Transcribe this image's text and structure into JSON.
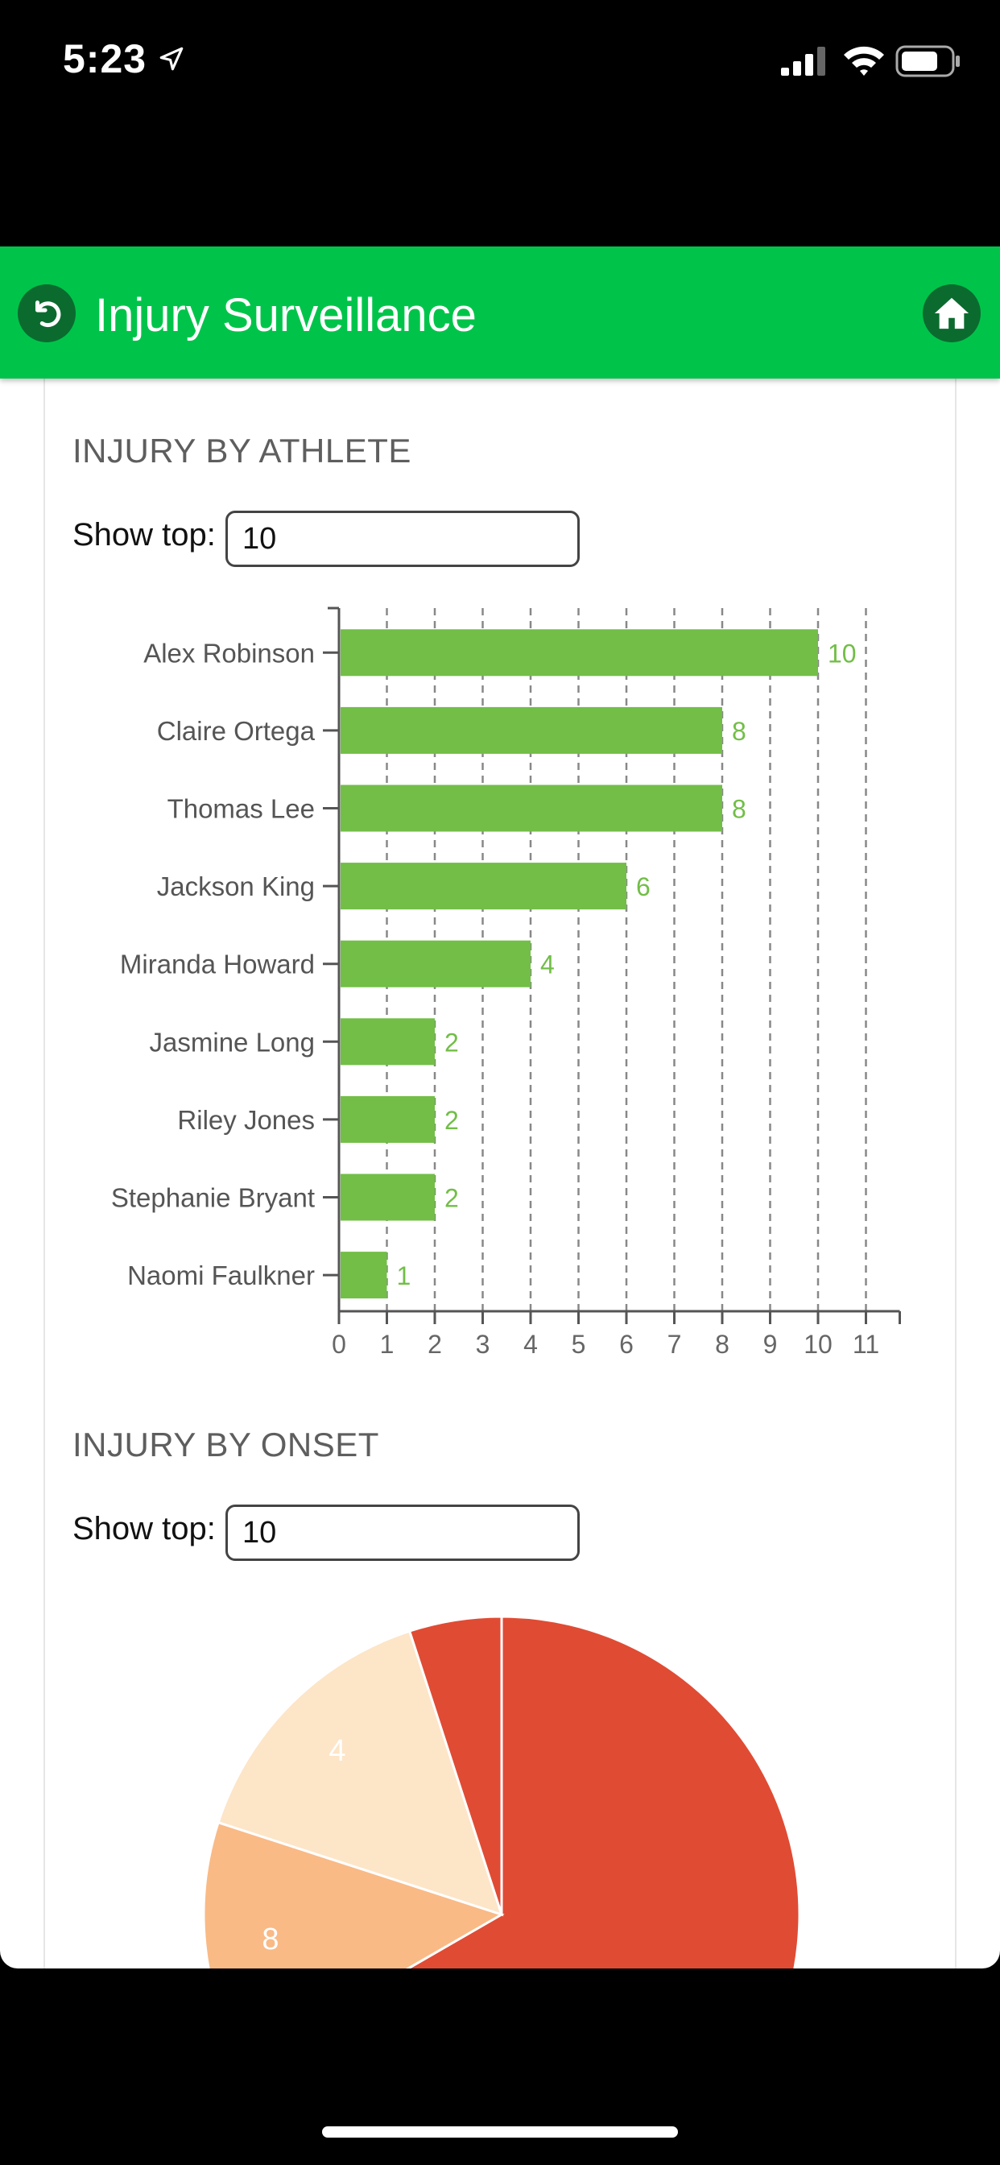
{
  "status_bar": {
    "time": "5:23",
    "icons": [
      "location-arrow-icon",
      "cellular-signal-icon",
      "wifi-icon",
      "battery-icon"
    ]
  },
  "header": {
    "title": "Injury Surveillance",
    "back_icon": "back-arrow-icon",
    "home_icon": "home-icon",
    "color": "#00c44a"
  },
  "athlete_section": {
    "title": "INJURY BY ATHLETE",
    "show_top_label": "Show top:",
    "show_top_value": "10"
  },
  "onset_section": {
    "title": "INJURY BY ONSET",
    "show_top_label": "Show top:",
    "show_top_value": "10"
  },
  "chart_data": [
    {
      "type": "bar",
      "orientation": "horizontal",
      "categories": [
        "Alex Robinson",
        "Claire Ortega",
        "Thomas Lee",
        "Jackson King",
        "Miranda Howard",
        "Jasmine Long",
        "Riley Jones",
        "Stephanie Bryant",
        "Naomi Faulkner"
      ],
      "values": [
        10,
        8,
        8,
        6,
        4,
        2,
        2,
        2,
        1
      ],
      "xlim": [
        0,
        11
      ],
      "xticks": [
        "0",
        "1",
        "2",
        "3",
        "4",
        "5",
        "6",
        "7",
        "8",
        "9",
        "10",
        "11"
      ],
      "grid": "vertical dashed",
      "bar_color": "#72be47",
      "data_labels": true
    },
    {
      "type": "pie",
      "partial": true,
      "slices": [
        {
          "value_label": "",
          "color": "#e04b34"
        },
        {
          "value_label": "8",
          "color": "#f9ba86"
        },
        {
          "value_label": "4",
          "color": "#fde5c8"
        },
        {
          "value_label": "",
          "color": "#e04b34"
        }
      ]
    }
  ]
}
